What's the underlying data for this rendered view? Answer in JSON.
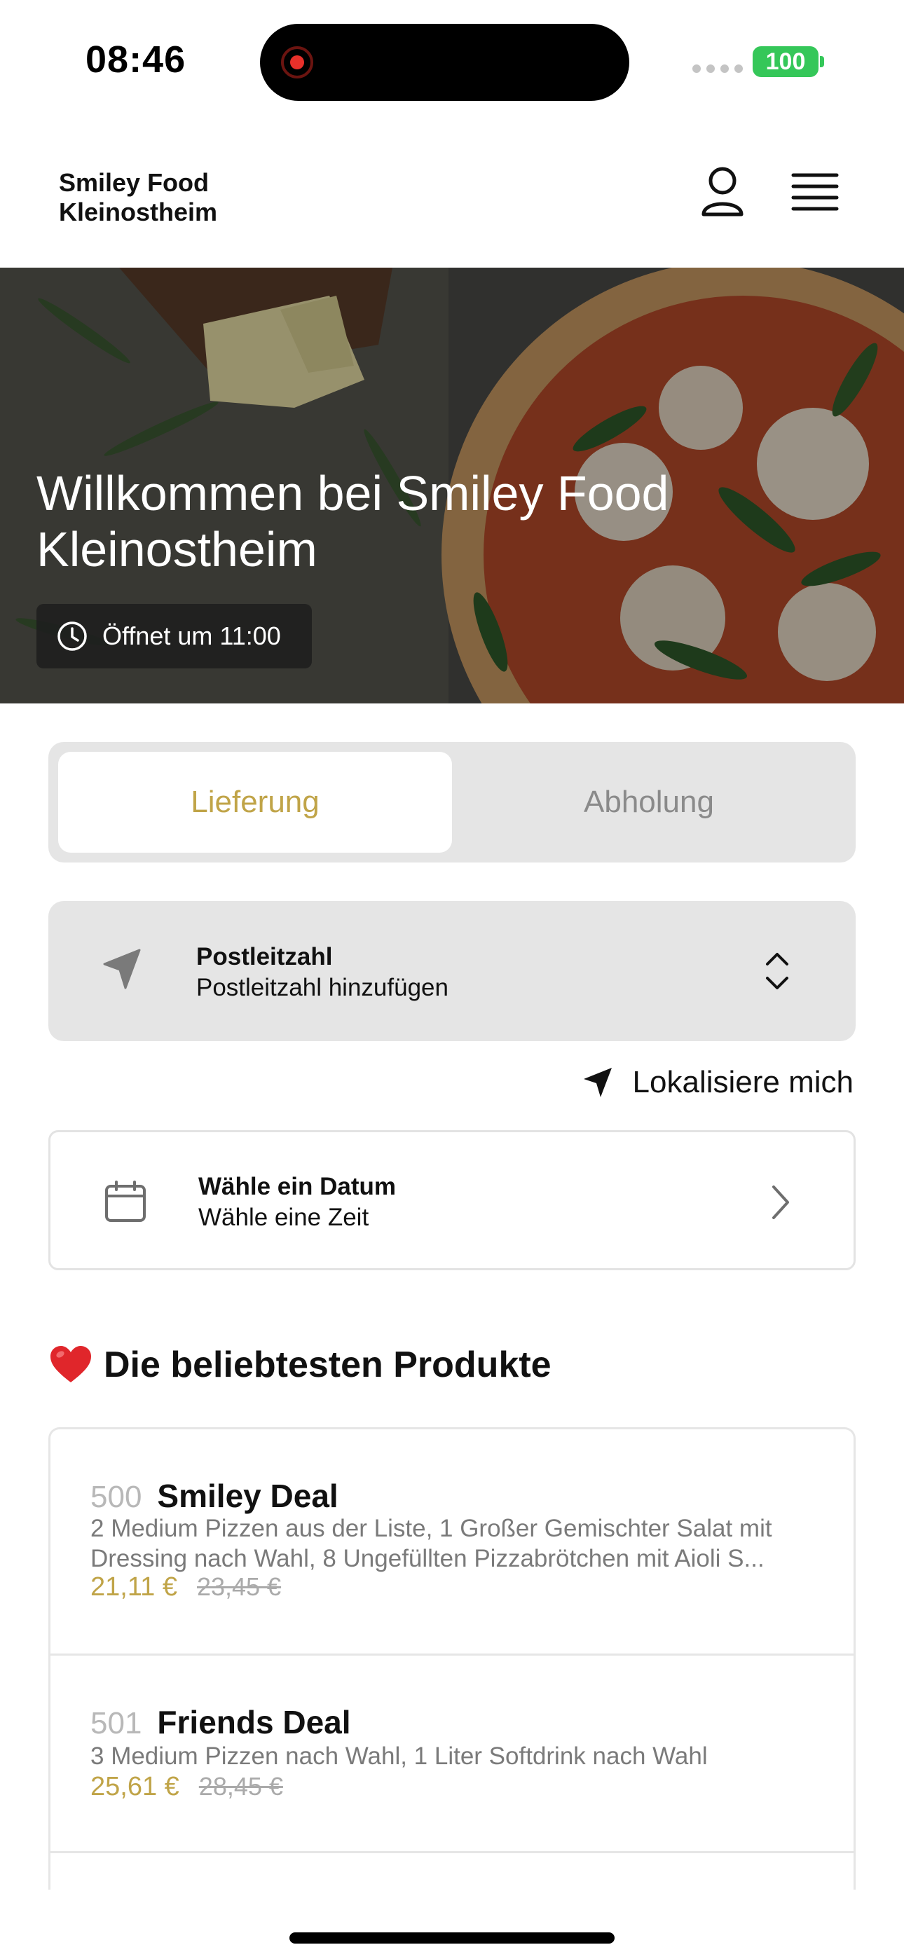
{
  "status_bar": {
    "time": "08:46",
    "battery": "100"
  },
  "header": {
    "brand_line1": "Smiley Food",
    "brand_line2": "Kleinostheim"
  },
  "hero": {
    "title": "Willkommen bei Smiley Food Kleinostheim",
    "opening": "Öffnet um 11:00"
  },
  "mode_toggle": {
    "delivery": "Lieferung",
    "pickup": "Abholung",
    "selected": "Lieferung"
  },
  "postal": {
    "title": "Postleitzahl",
    "subtitle": "Postleitzahl hinzufügen"
  },
  "locate": {
    "label": "Lokalisiere mich"
  },
  "date_picker": {
    "title": "Wähle ein Datum",
    "subtitle": "Wähle eine Zeit"
  },
  "popular": {
    "emoji": "❤️",
    "heading": "Die beliebtesten Produkte",
    "products": [
      {
        "number": "500",
        "name": "Smiley Deal",
        "description_line1": "2 Medium Pizzen aus der Liste, 1 Großer Gemischter Salat mit",
        "description_line2": "Dressing nach Wahl, 8 Ungefüllten Pizzabrötchen mit Aioli S...",
        "price": "21,11 €",
        "old_price": "23,45 €"
      },
      {
        "number": "501",
        "name": "Friends Deal",
        "description_line1": "3 Medium Pizzen nach Wahl, 1 Liter Softdrink nach Wahl",
        "price": "25,61 €",
        "old_price": "28,45 €"
      }
    ]
  },
  "colors": {
    "accent": "#c0a448",
    "panel": "#e5e5e5",
    "battery": "#35c759"
  }
}
